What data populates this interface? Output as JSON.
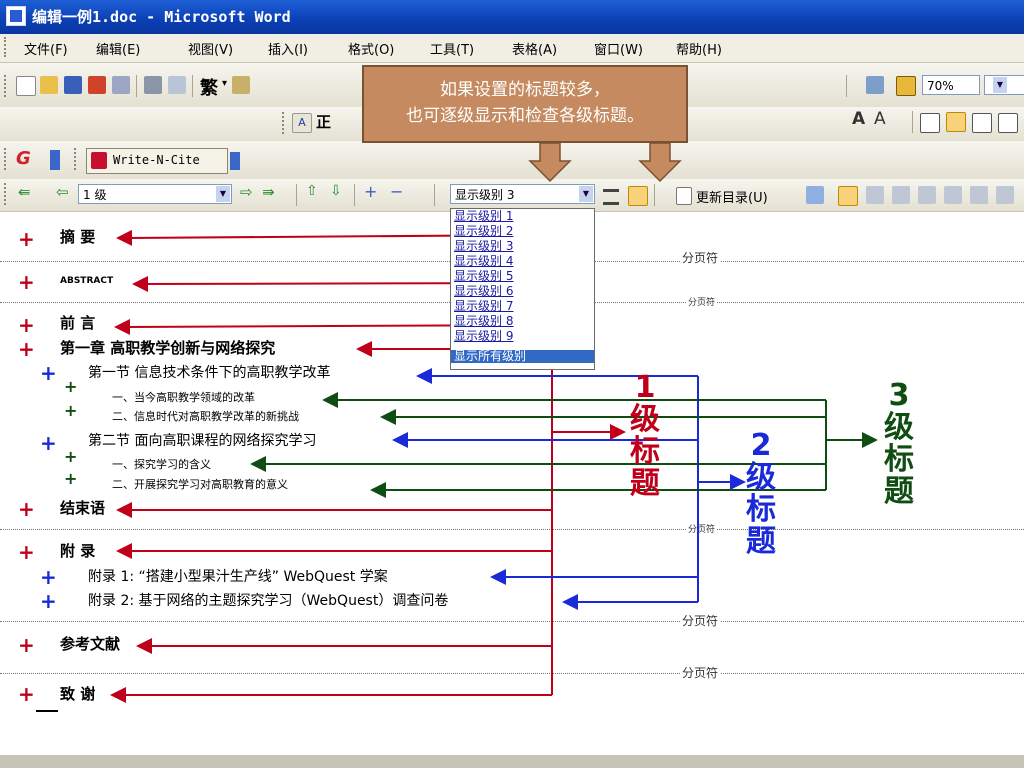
{
  "window": {
    "title": "编辑一例1.doc - Microsoft Word"
  },
  "menu": [
    "文件(F)",
    "编辑(E)",
    "视图(V)",
    "插入(I)",
    "格式(O)",
    "工具(T)",
    "表格(A)",
    "窗口(W)",
    "帮助(H)"
  ],
  "toolbar": {
    "trad_chinese": "繁",
    "zoom": "70%",
    "style_prefix": "正",
    "plugin": "Write-N-Cite"
  },
  "outline_toolbar": {
    "level_select": "1 级",
    "show_level": "显示级别 3",
    "update_toc": "更新目录(U)"
  },
  "callout": {
    "line1": "如果设置的标题较多，",
    "line2": "也可逐级显示和检查各级标题。"
  },
  "dropdown": {
    "options": [
      "显示级别 1",
      "显示级别 2",
      "显示级别 3",
      "显示级别 4",
      "显示级别 5",
      "显示级别 6",
      "显示级别 7",
      "显示级别 8",
      "显示级别 9",
      "显示所有级别"
    ],
    "selected": "显示所有级别"
  },
  "document": {
    "headings": {
      "abstract_cn": "摘 要",
      "abstract_en": "ABSTRACT",
      "preface": "前 言",
      "chapter1": "第一章 高职教学创新与网络探究",
      "section1": "第一节 信息技术条件下的高职教学改革",
      "s1_item1": "一、当今高职教学领域的改革",
      "s1_item2": "二、信息时代对高职教学改革的新挑战",
      "section2": "第二节 面向高职课程的网络探究学习",
      "s2_item1": "一、探究学习的含义",
      "s2_item2": "二、开展探究学习对高职教育的意义",
      "conclusion": "结束语",
      "appendix": "附 录",
      "appendix1": "附录 1: “搭建小型果汁生产线” WebQuest 学案",
      "appendix2": "附录 2: 基于网络的主题探究学习（WebQuest）调查问卷",
      "references": "参考文献",
      "thanks": "致 谢"
    },
    "page_break": "分页符",
    "page_break_small": "分页符"
  },
  "annotations": {
    "level1": "1级标题",
    "level2": "2级标题",
    "level3": "3级标题"
  },
  "colors": {
    "level1": "#c0001a",
    "level2": "#1a2ad8",
    "level3": "#0f4d12",
    "callout": "#c58a5f",
    "titlebar": "#0a3fb4"
  }
}
